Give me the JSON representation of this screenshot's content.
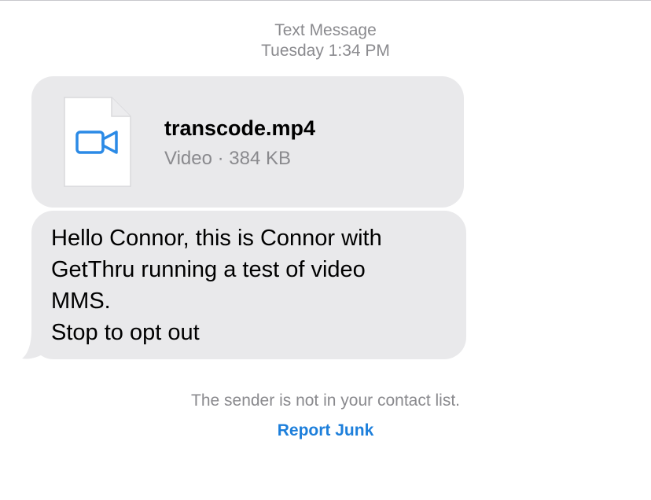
{
  "header": {
    "service": "Text Message",
    "timestamp": "Tuesday 1:34 PM"
  },
  "attachment": {
    "file_name": "transcode.mp4",
    "file_meta": "Video · 384 KB",
    "icon": "video-camera-icon"
  },
  "message": {
    "text": "Hello Connor, this is Connor with\nGetThru running a test of video\nMMS.\nStop to opt out"
  },
  "footer": {
    "notice": "The sender is not in your contact list.",
    "report_junk_label": "Report Junk"
  },
  "colors": {
    "bubble": "#e9e9eb",
    "accent": "#1d7fdb",
    "secondary_text": "#8a8a8e"
  }
}
